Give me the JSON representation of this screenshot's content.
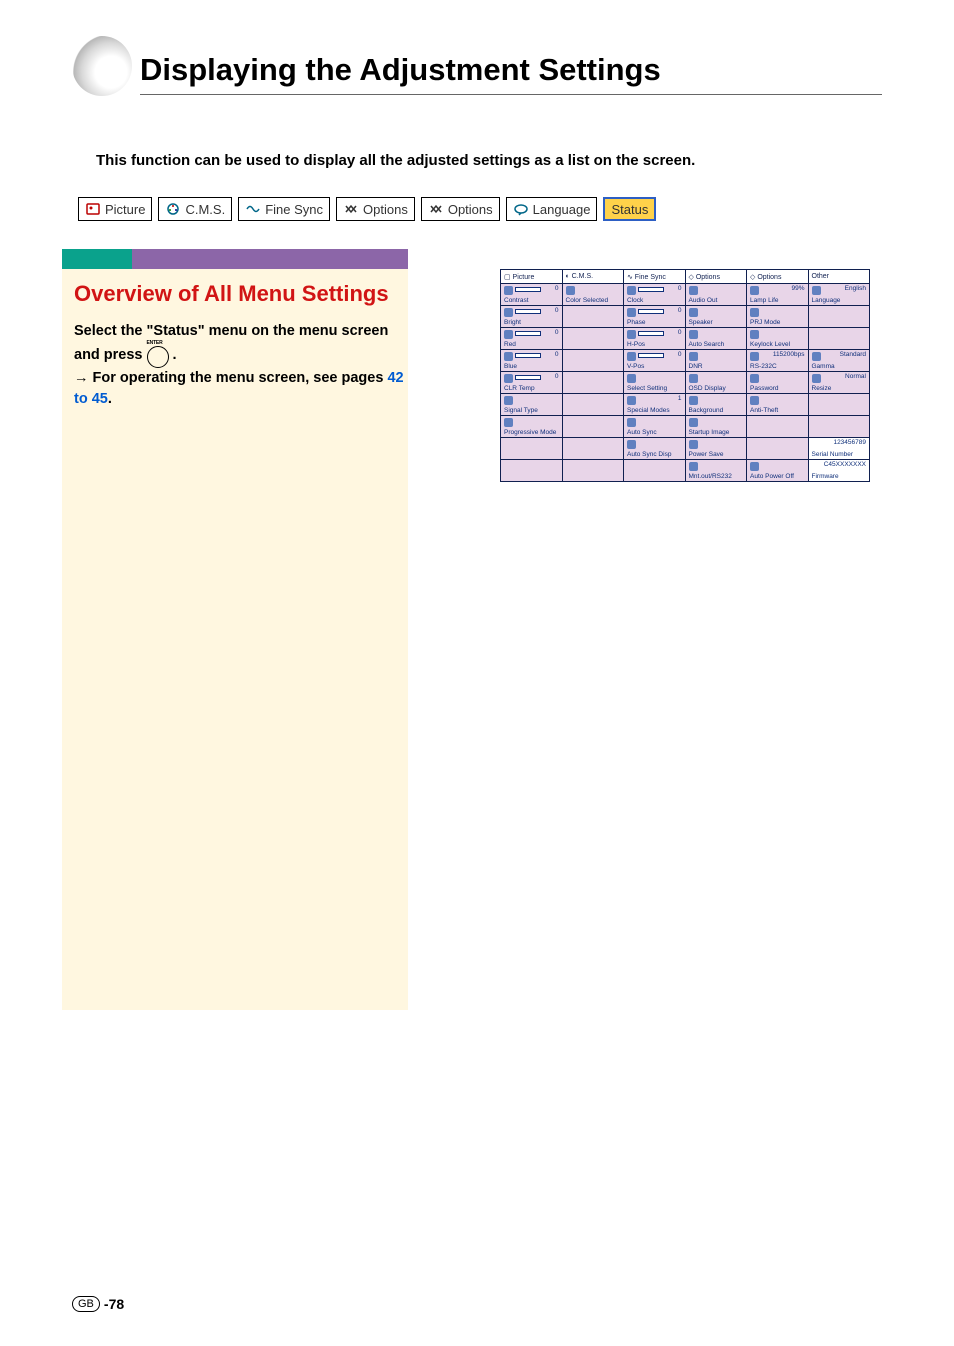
{
  "page_title": "Displaying the Adjustment Settings",
  "intro_text": "This function can be used to display all the adjusted settings as a list on the screen.",
  "tabs": [
    {
      "label": "Picture"
    },
    {
      "label": "C.M.S."
    },
    {
      "label": "Fine Sync"
    },
    {
      "label": "Options"
    },
    {
      "label": "Options"
    },
    {
      "label": "Language"
    },
    {
      "label": "Status"
    }
  ],
  "section_title": "Overview of All Menu Settings",
  "body": {
    "line1": "Select the \"Status\" menu on the menu screen and press ",
    "line1_end": " .",
    "line2_prefix": "→ For operating the menu screen, see pages ",
    "link": "42 to 45",
    "line2_suffix": "."
  },
  "status_headers": [
    "Picture",
    "C.M.S.",
    "Fine Sync",
    "Options",
    "Options",
    "Other"
  ],
  "status_rows": [
    [
      {
        "lbl": "Contrast",
        "val": "0",
        "ico": "contrast",
        "bar": true
      },
      {
        "lbl": "Color Selected",
        "ico": "palette"
      },
      {
        "lbl": "Clock",
        "val": "0",
        "ico": "clock",
        "bar": true
      },
      {
        "lbl": "Audio Out",
        "ico": "audio"
      },
      {
        "lbl": "Lamp Life",
        "val": "99%",
        "ico": "lamp"
      },
      {
        "lbl": "Language",
        "val": "English",
        "ico": "globe"
      }
    ],
    [
      {
        "lbl": "Bright",
        "val": "0",
        "ico": "sun",
        "bar": true
      },
      {
        "empty": true
      },
      {
        "lbl": "Phase",
        "val": "0",
        "ico": "phase",
        "bar": true
      },
      {
        "lbl": "Speaker",
        "ico": "speaker"
      },
      {
        "lbl": "PRJ Mode",
        "ico": "prj"
      },
      {
        "empty": true
      }
    ],
    [
      {
        "lbl": "Red",
        "val": "0",
        "ico": "red",
        "bar": true
      },
      {
        "empty": true
      },
      {
        "lbl": "H-Pos",
        "val": "0",
        "ico": "hpos",
        "bar": true
      },
      {
        "lbl": "Auto Search",
        "ico": "search"
      },
      {
        "lbl": "Keylock Level",
        "ico": "lock"
      },
      {
        "empty": true
      }
    ],
    [
      {
        "lbl": "Blue",
        "val": "0",
        "ico": "blue",
        "bar": true
      },
      {
        "empty": true
      },
      {
        "lbl": "V-Pos",
        "val": "0",
        "ico": "vpos",
        "bar": true
      },
      {
        "lbl": "DNR",
        "ico": "dnr"
      },
      {
        "lbl": "RS-232C",
        "val": "115200bps",
        "ico": "rs232"
      },
      {
        "lbl": "Gamma",
        "val": "Standard",
        "ico": "gamma"
      }
    ],
    [
      {
        "lbl": "CLR Temp",
        "val": "0",
        "ico": "temp",
        "bar": true
      },
      {
        "empty": true
      },
      {
        "lbl": "Select Setting",
        "ico": "select"
      },
      {
        "lbl": "OSD Display",
        "ico": "osd"
      },
      {
        "lbl": "Password",
        "ico": "pass"
      },
      {
        "lbl": "Resize",
        "val": "Normal",
        "ico": "resize"
      }
    ],
    [
      {
        "lbl": "Signal Type",
        "ico": "signal"
      },
      {
        "empty": true
      },
      {
        "lbl": "Special Modes",
        "val": "1",
        "ico": "special"
      },
      {
        "lbl": "Background",
        "ico": "bg"
      },
      {
        "lbl": "Anti-Theft",
        "ico": "theft"
      },
      {
        "empty": true
      }
    ],
    [
      {
        "lbl": "Progressive Mode",
        "ico": "prog"
      },
      {
        "empty": true
      },
      {
        "lbl": "Auto Sync",
        "ico": "sync"
      },
      {
        "lbl": "Startup Image",
        "ico": "startup"
      },
      {
        "empty": true
      },
      {
        "empty": true
      }
    ],
    [
      {
        "empty": true
      },
      {
        "empty": true
      },
      {
        "lbl": "Auto Sync Disp",
        "ico": "syncdisp"
      },
      {
        "lbl": "Power Save",
        "ico": "power"
      },
      {
        "empty": true
      },
      {
        "lbl": "Serial Number",
        "val": "123456789",
        "white": true
      }
    ],
    [
      {
        "empty": true
      },
      {
        "empty": true
      },
      {
        "empty": true
      },
      {
        "lbl": "Mnt.out/RS232",
        "ico": "mnt"
      },
      {
        "lbl": "Auto Power Off",
        "ico": "autopower"
      },
      {
        "lbl": "Firmware",
        "val": "C45XXXXXXX",
        "white": true
      }
    ]
  ],
  "footer": {
    "gb": "GB",
    "page": "-78"
  }
}
